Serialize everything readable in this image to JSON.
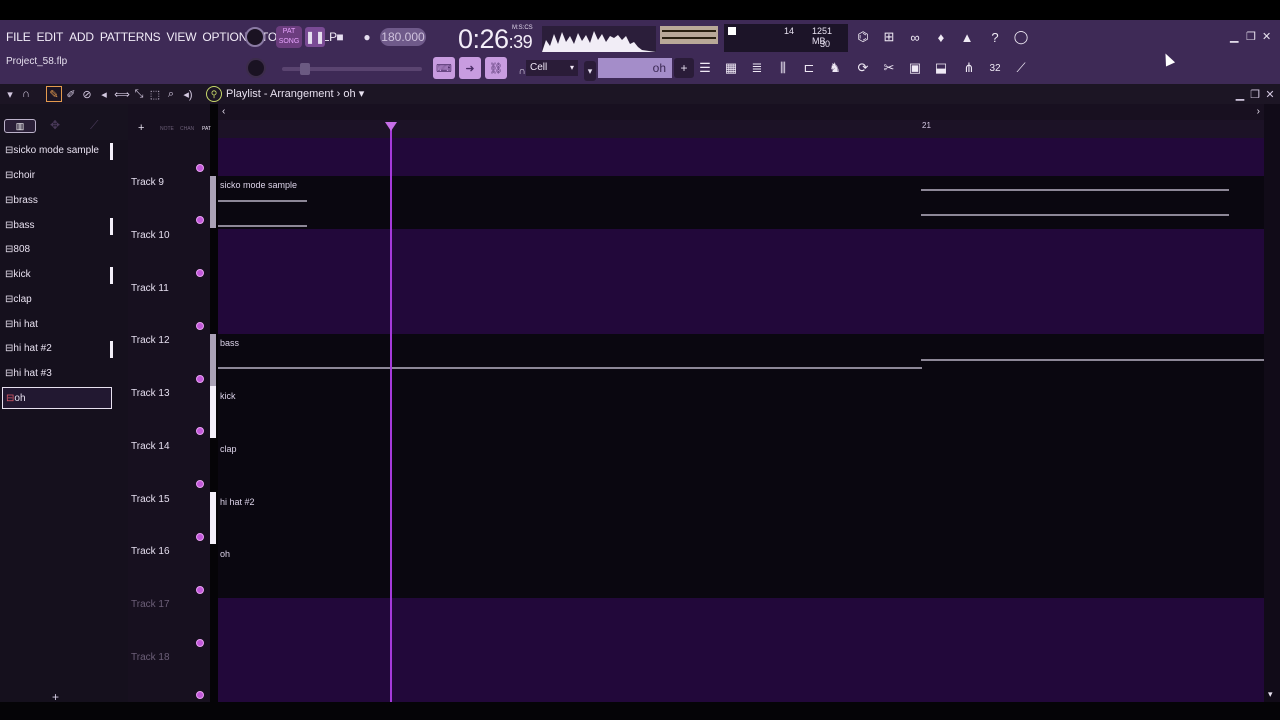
{
  "menu": [
    "FILE",
    "EDIT",
    "ADD",
    "PATTERNS",
    "VIEW",
    "OPTIONS",
    "TOOLS",
    "HELP"
  ],
  "project_name": "Project_58.flp",
  "transport": {
    "pat_label": "PAT",
    "song_label": "SONG",
    "tempo": "180.000",
    "time_main": "0:26",
    "time_sub": ":39",
    "time_unit": "M:S:CS"
  },
  "cpu": {
    "count": "14",
    "memory": "1251 MB",
    "polyphony": "30"
  },
  "snap": {
    "value": "Cell"
  },
  "pattern_selector": {
    "current": "oh",
    "add": "+"
  },
  "playlist": {
    "title": "Playlist - Arrangement",
    "separator": "›",
    "pattern": "oh"
  },
  "browser": {
    "tabs": [
      "NOTE",
      "CHAN",
      "PAT"
    ],
    "add_label": "+"
  },
  "patterns": [
    {
      "name": "sicko mode sample",
      "marked": true
    },
    {
      "name": "choir",
      "marked": false
    },
    {
      "name": "brass",
      "marked": false
    },
    {
      "name": "bass",
      "marked": true
    },
    {
      "name": "808",
      "marked": false
    },
    {
      "name": "kick",
      "marked": true
    },
    {
      "name": "clap",
      "marked": false
    },
    {
      "name": "hi hat",
      "marked": false
    },
    {
      "name": "hi hat #2",
      "marked": true
    },
    {
      "name": "hi hat #3",
      "marked": false
    },
    {
      "name": "oh",
      "marked": false,
      "selected": true
    }
  ],
  "tracks": [
    "Track 9",
    "Track 10",
    "Track 11",
    "Track 12",
    "Track 13",
    "Track 14",
    "Track 15",
    "Track 16",
    "Track 17",
    "Track 18"
  ],
  "ruler": {
    "bar_label": "21"
  },
  "clips": [
    {
      "track": "Track 9",
      "label": "sicko mode sample"
    },
    {
      "track": "Track 12",
      "label": "bass"
    },
    {
      "track": "Track 13",
      "label": "kick"
    },
    {
      "track": "Track 14",
      "label": "clap"
    },
    {
      "track": "Track 15",
      "label": "hi hat #2"
    },
    {
      "track": "Track 16",
      "label": "oh"
    }
  ],
  "colors": {
    "accent": "#c258d9",
    "playlist_bg": "#22083a",
    "toolbar_bg": "#3e2a56"
  }
}
